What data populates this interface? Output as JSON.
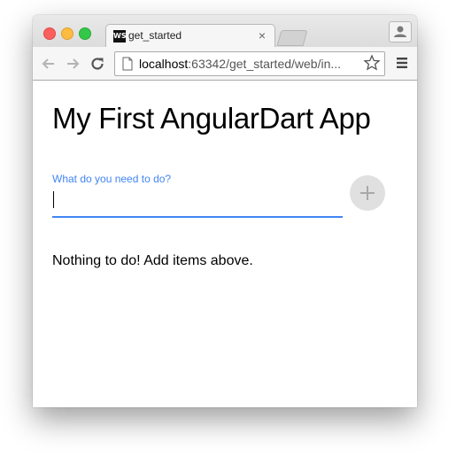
{
  "browser": {
    "tab": {
      "favicon_text": "WS",
      "title": "get_started",
      "close_glyph": "×"
    },
    "address_bar": {
      "host": "localhost",
      "path": ":63342/get_started/web/in..."
    },
    "icons": {
      "back": "back-arrow-icon",
      "forward": "forward-arrow-icon",
      "reload": "reload-icon",
      "page": "page-icon",
      "bookmark": "star-icon",
      "menu": "hamburger-menu-icon",
      "profile": "person-icon"
    },
    "colors": {
      "close": "#fc605c",
      "minimize": "#fdbc40",
      "zoom": "#34c84a"
    }
  },
  "page": {
    "title": "My First AngularDart App",
    "input": {
      "label": "What do you need to do?",
      "value": ""
    },
    "add_button": {
      "icon": "plus-icon"
    },
    "empty_message": "Nothing to do! Add items above."
  },
  "theme": {
    "accent": "#4285f4",
    "button_bg": "#e0e0e0"
  }
}
